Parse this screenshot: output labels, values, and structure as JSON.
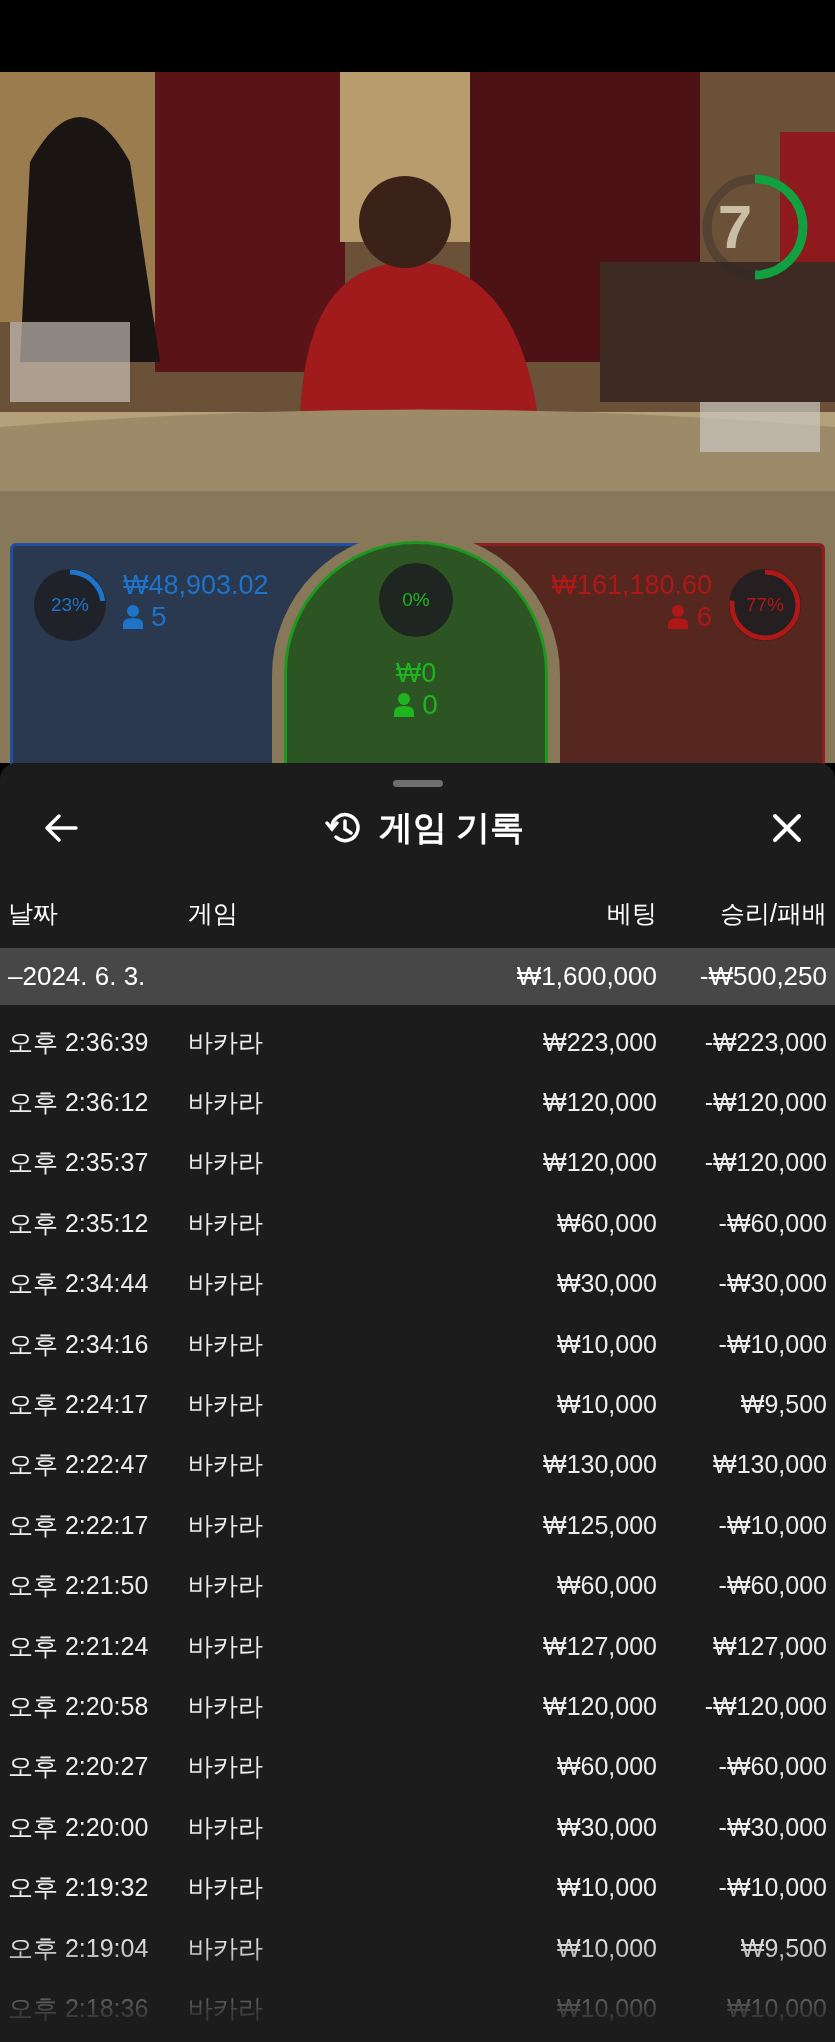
{
  "video": {
    "countdown": {
      "value": "7",
      "level": 0.5
    }
  },
  "bets": [
    {
      "kind": "player",
      "percent": "23%",
      "level": 0.23,
      "amount": "₩48,903.02",
      "players": "5"
    },
    {
      "kind": "tie",
      "percent": "0%",
      "amount": "₩0",
      "players": "0"
    },
    {
      "kind": "banker",
      "percent": "77%",
      "level": 0.77,
      "amount": "₩161,180.60",
      "players": "6"
    }
  ],
  "history": {
    "title": "게임 기록",
    "columns": [
      "날짜",
      "게임",
      "베팅",
      "승리/패배"
    ],
    "date_row": {
      "date": "–2024. 6. 3.",
      "bet": "₩1,600,000",
      "result": "-₩500,250"
    },
    "rows": [
      {
        "time": "오후 2:36:39",
        "game": "바카라",
        "bet": "₩223,000",
        "result": "-₩223,000"
      },
      {
        "time": "오후 2:36:12",
        "game": "바카라",
        "bet": "₩120,000",
        "result": "-₩120,000"
      },
      {
        "time": "오후 2:35:37",
        "game": "바카라",
        "bet": "₩120,000",
        "result": "-₩120,000"
      },
      {
        "time": "오후 2:35:12",
        "game": "바카라",
        "bet": "₩60,000",
        "result": "-₩60,000"
      },
      {
        "time": "오후 2:34:44",
        "game": "바카라",
        "bet": "₩30,000",
        "result": "-₩30,000"
      },
      {
        "time": "오후 2:34:16",
        "game": "바카라",
        "bet": "₩10,000",
        "result": "-₩10,000"
      },
      {
        "time": "오후 2:24:17",
        "game": "바카라",
        "bet": "₩10,000",
        "result": "₩9,500"
      },
      {
        "time": "오후 2:22:47",
        "game": "바카라",
        "bet": "₩130,000",
        "result": "₩130,000"
      },
      {
        "time": "오후 2:22:17",
        "game": "바카라",
        "bet": "₩125,000",
        "result": "-₩10,000"
      },
      {
        "time": "오후 2:21:50",
        "game": "바카라",
        "bet": "₩60,000",
        "result": "-₩60,000"
      },
      {
        "time": "오후 2:21:24",
        "game": "바카라",
        "bet": "₩127,000",
        "result": "₩127,000"
      },
      {
        "time": "오후 2:20:58",
        "game": "바카라",
        "bet": "₩120,000",
        "result": "-₩120,000"
      },
      {
        "time": "오후 2:20:27",
        "game": "바카라",
        "bet": "₩60,000",
        "result": "-₩60,000"
      },
      {
        "time": "오후 2:20:00",
        "game": "바카라",
        "bet": "₩30,000",
        "result": "-₩30,000"
      },
      {
        "time": "오후 2:19:32",
        "game": "바카라",
        "bet": "₩10,000",
        "result": "-₩10,000"
      },
      {
        "time": "오후 2:19:04",
        "game": "바카라",
        "bet": "₩10,000",
        "result": "₩9,500"
      },
      {
        "time": "오후 2:18:36",
        "game": "바카라",
        "bet": "₩10,000",
        "result": "₩10,000"
      }
    ]
  }
}
